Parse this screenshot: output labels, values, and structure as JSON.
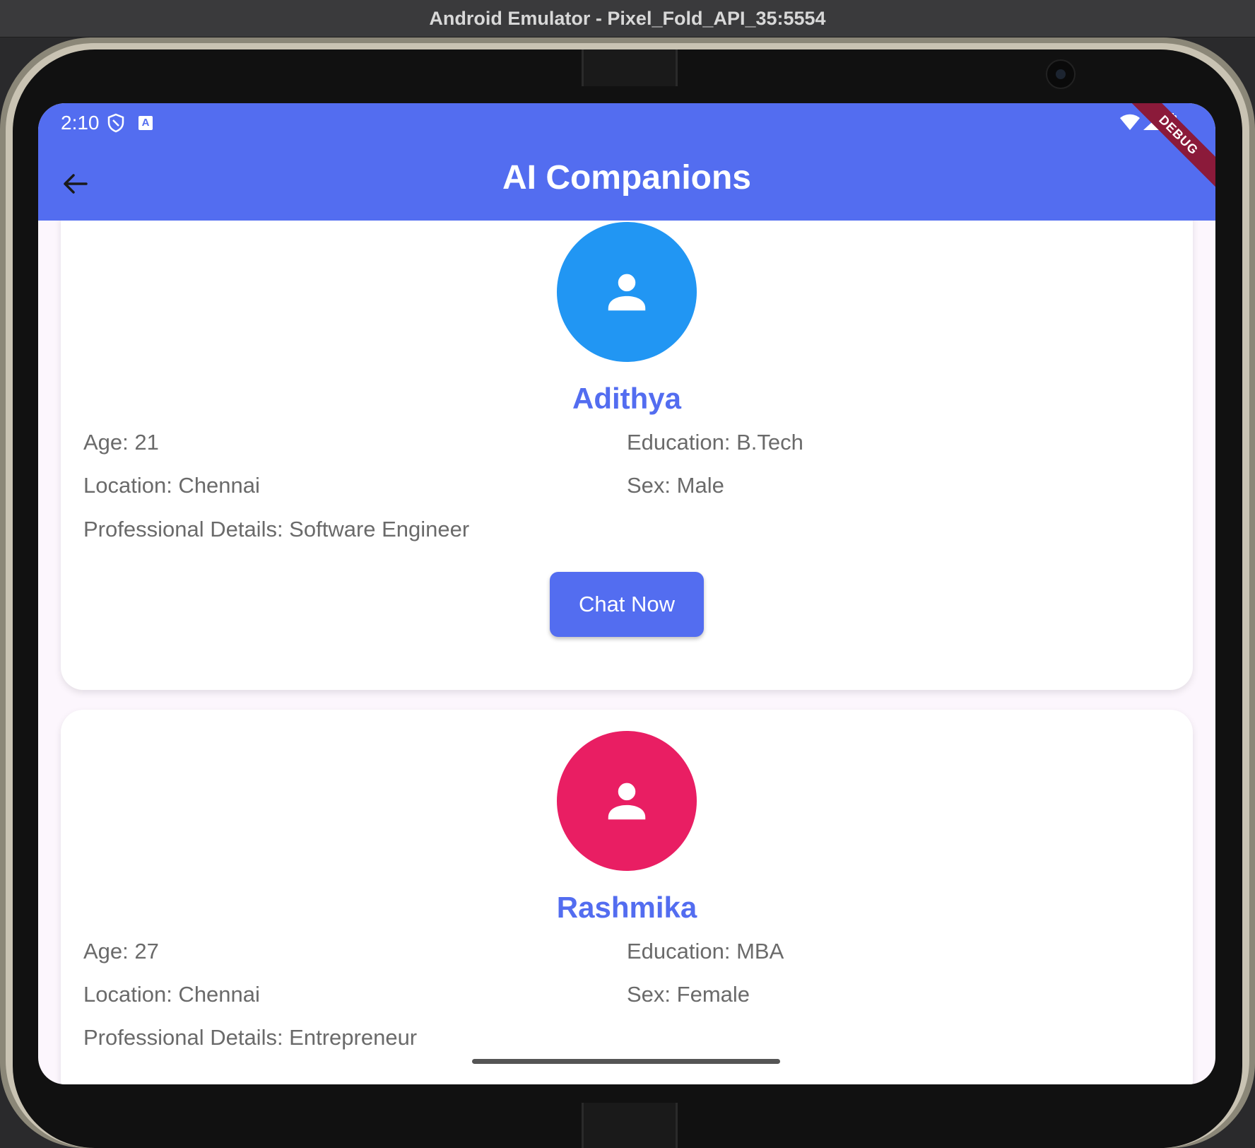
{
  "window": {
    "title": "Android Emulator - Pixel_Fold_API_35:5554"
  },
  "status_bar": {
    "time": "2:10",
    "debug_label": "DEBUG"
  },
  "app_bar": {
    "title": "AI Companions"
  },
  "companions": [
    {
      "name": "Adithya",
      "avatar_color": "#2196f3",
      "age": "Age: 21",
      "education": "Education: B.Tech",
      "location": "Location: Chennai",
      "sex": "Sex: Male",
      "professional": "Professional Details: Software Engineer",
      "button_label": "Chat Now"
    },
    {
      "name": "Rashmika",
      "avatar_color": "#e91e63",
      "age": "Age: 27",
      "education": "Education: MBA",
      "location": "Location: Chennai",
      "sex": "Sex: Female",
      "professional": "Professional Details: Entrepreneur"
    }
  ],
  "colors": {
    "primary": "#536df0",
    "background": "#fcf6fd"
  },
  "icons": [
    "shield-icon",
    "font-icon",
    "wifi-icon",
    "signal-icon",
    "battery-icon",
    "back-arrow-icon",
    "person-icon"
  ]
}
